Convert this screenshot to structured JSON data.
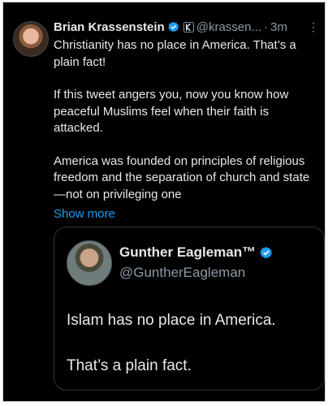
{
  "tweet": {
    "author_name": "Brian Krassenstein",
    "handle": "@krassen...",
    "time": "3m",
    "menu_glyph": "⋮",
    "paragraphs": [
      "Christianity has no place in America. That’s a plain fact!",
      "If this tweet angers you, now you know how peaceful Muslims feel when their faith is attacked.",
      "America was founded on principles of religious freedom and the separation of church and state—not on privileging one"
    ],
    "show_more": "Show more"
  },
  "quoted": {
    "author_name": "Gunther Eagleman™",
    "handle": "@GuntherEagleman",
    "lines": [
      "Islam has no place in America.",
      "That’s a plain fact."
    ]
  },
  "colors": {
    "background": "#000000",
    "text": "#e7e9ea",
    "secondary": "#8b98a5",
    "accent": "#1d9bf0"
  },
  "icons": [
    "verified-badge-icon",
    "k-affiliate-icon",
    "more-options-icon"
  ]
}
